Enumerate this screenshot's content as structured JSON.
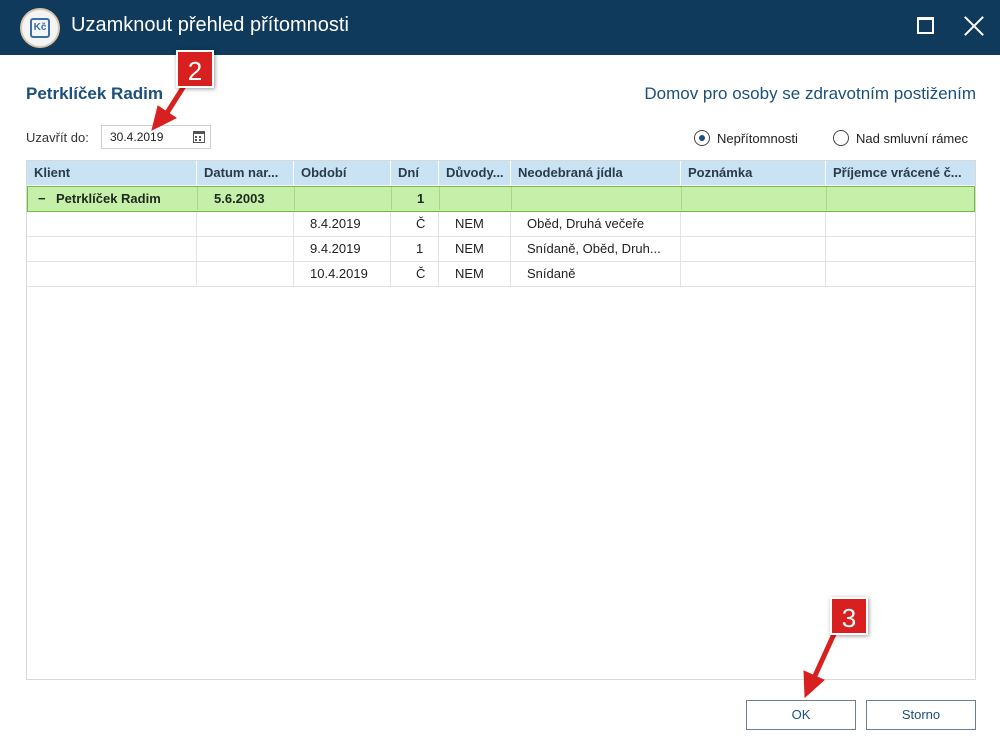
{
  "window": {
    "title": "Uzamknout přehled přítomnosti",
    "app_icon_text": "Kč"
  },
  "header": {
    "client_name": "Petrklíček Radim",
    "organization": "Domov pro osoby se zdravotním postižením"
  },
  "filter": {
    "close_label": "Uzavřít do:",
    "close_date": "30.4.2019",
    "radio_absence": "Nepřítomnosti",
    "radio_over_limit": "Nad smluvní rámec",
    "selected": "Nepřítomnosti"
  },
  "grid": {
    "columns": [
      "Klient",
      "Datum nar...",
      "Období",
      "Dní",
      "Důvody...",
      "Neodebraná jídla",
      "Poznámka",
      "Příjemce vrácené č..."
    ],
    "group": {
      "toggle": "−",
      "client": "Petrklíček Radim",
      "birth_date": "5.6.2003",
      "days": "1"
    },
    "rows": [
      {
        "period": "8.4.2019",
        "days": "Č",
        "reason": "NEM",
        "meals": "Oběd, Druhá večeře"
      },
      {
        "period": "9.4.2019",
        "days": "1",
        "reason": "NEM",
        "meals": "Snídaně, Oběd, Druh..."
      },
      {
        "period": "10.4.2019",
        "days": "Č",
        "reason": "NEM",
        "meals": "Snídaně"
      }
    ]
  },
  "buttons": {
    "ok": "OK",
    "cancel": "Storno"
  },
  "annotations": {
    "step_2": "2",
    "step_3": "3"
  },
  "colors": {
    "titlebar": "#0f3a5c",
    "accent_text": "#1c4f7c",
    "header_row": "#c9e2f4",
    "group_row": "#c6efa9",
    "group_border": "#6bbf3c",
    "annotation": "#d82020"
  }
}
